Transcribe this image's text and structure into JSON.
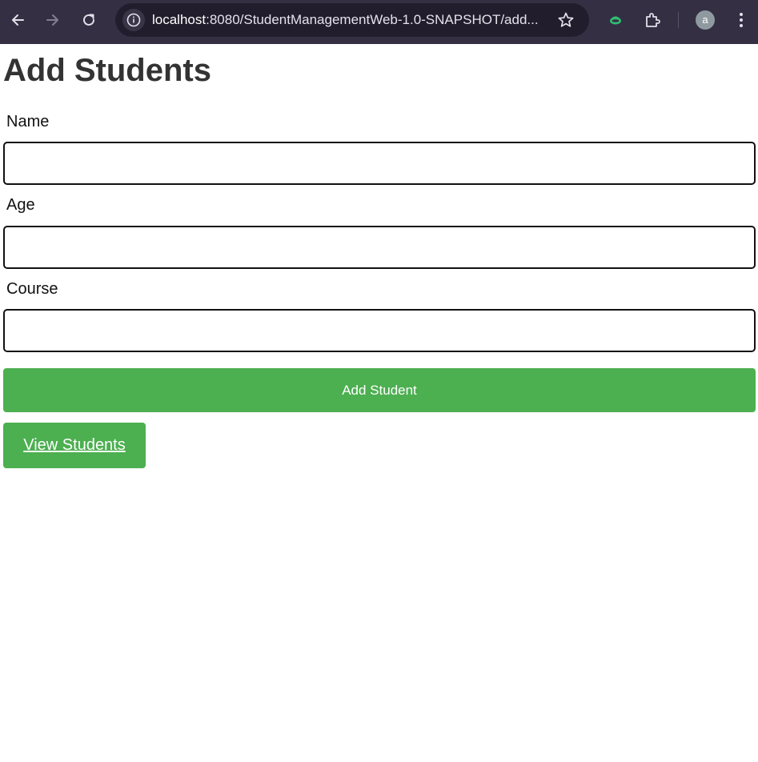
{
  "browser": {
    "url_host": "localhost",
    "url_rest": ":8080/StudentManagementWeb-1.0-SNAPSHOT/add...",
    "avatar_letter": "a",
    "icons": {
      "back": "back-arrow-icon",
      "forward": "forward-arrow-icon",
      "reload": "reload-icon",
      "site_info": "info-icon",
      "bookmark": "star-icon",
      "extension": "green-extension-icon",
      "extensions_menu": "puzzle-icon",
      "menu": "kebab-menu-icon"
    }
  },
  "page": {
    "title": "Add Students",
    "form": {
      "name_label": "Name",
      "name_value": "",
      "age_label": "Age",
      "age_value": "",
      "course_label": "Course",
      "course_value": "",
      "submit_label": "Add Student"
    },
    "view_link_label": "View Students"
  },
  "colors": {
    "chrome_bg": "#352f44",
    "omnibox_bg": "#221d2c",
    "button_green": "#4caf50",
    "title_text": "#333333"
  }
}
